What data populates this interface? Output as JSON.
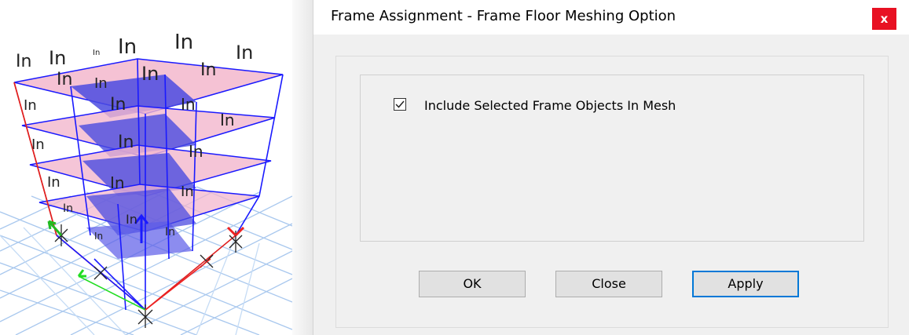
{
  "viewport": {
    "frame_labels": [
      "In",
      "In",
      "In",
      "In",
      "In",
      "In",
      "In",
      "In",
      "In",
      "In",
      "In",
      "In",
      "In",
      "In",
      "In",
      "In",
      "In",
      "In",
      "In",
      "In",
      "In",
      "In",
      "In",
      "In"
    ]
  },
  "dialog": {
    "title": "Frame Assignment - Frame Floor Meshing Option",
    "close_glyph": "x",
    "checkbox": {
      "label": "Include Selected Frame Objects In Mesh",
      "checked": true
    },
    "buttons": {
      "ok": "OK",
      "close": "Close",
      "apply": "Apply"
    }
  },
  "colors": {
    "close_bg": "#e81123",
    "default_button_border": "#0078d7",
    "frame_blue": "#1a1aff",
    "frame_red": "#e02020",
    "slab_pink": "#f4b4cc",
    "slab_blue": "#5050e0",
    "grid_blue": "#a9c8ee"
  }
}
